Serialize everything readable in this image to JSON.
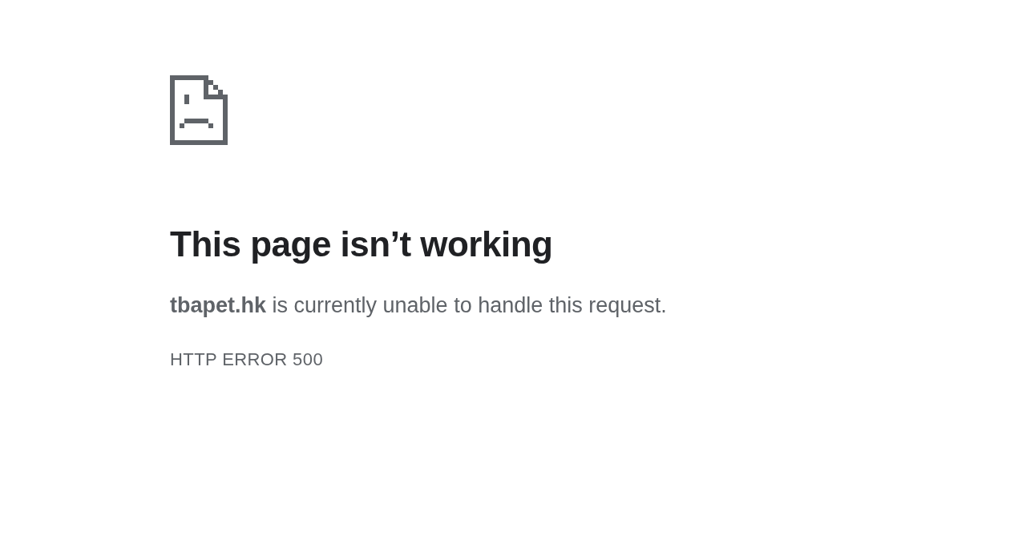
{
  "title": "This page isn’t working",
  "message": "**tbapet.hk** is currently unable to handle this request.",
  "error_code": "HTTP ERROR 500"
}
